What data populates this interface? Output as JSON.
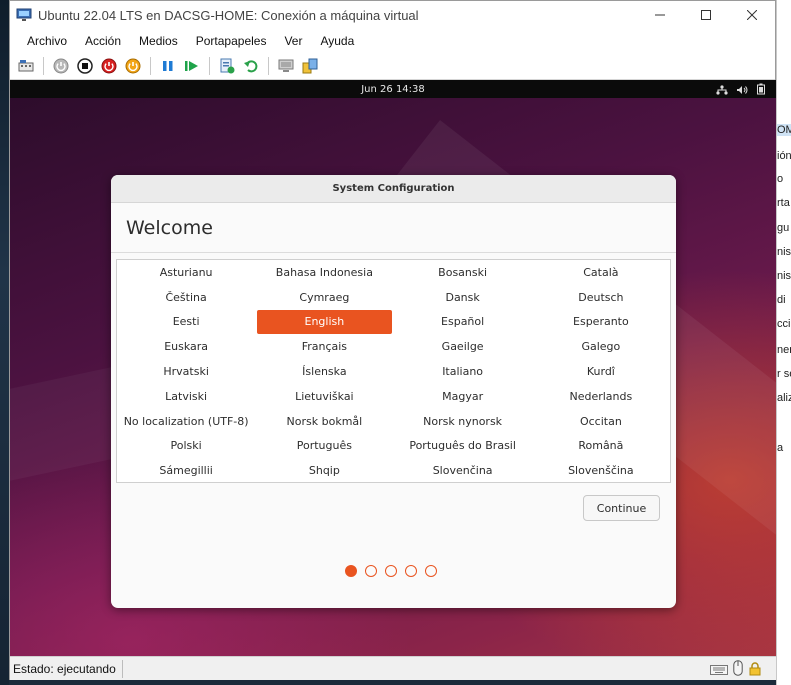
{
  "window": {
    "title": "Ubuntu 22.04 LTS en DACSG-HOME: Conexión a máquina virtual",
    "icon": "hyperv-vm-icon",
    "controls": [
      "minimize-icon",
      "maximize-icon",
      "close-icon"
    ]
  },
  "menu": [
    {
      "label": "Archivo"
    },
    {
      "label": "Acción"
    },
    {
      "label": "Medios"
    },
    {
      "label": "Portapapeles"
    },
    {
      "label": "Ver"
    },
    {
      "label": "Ayuda"
    }
  ],
  "toolbar": [
    "ctrl-alt-del-icon",
    "start-icon",
    "turn-off-icon",
    "shutdown-icon",
    "save-icon",
    "pause-icon",
    "resume-icon",
    "checkpoint-icon",
    "revert-icon",
    "enhanced-session-icon",
    "share-icon"
  ],
  "guest": {
    "clock": "Jun 26  14:38",
    "tray": [
      "network-icon",
      "volume-icon",
      "battery-icon"
    ]
  },
  "dialog": {
    "title": "System Configuration",
    "heading": "Welcome",
    "selected_language": "English",
    "languages": [
      "Asturianu",
      "Bahasa Indonesia",
      "Bosanski",
      "Català",
      "Čeština",
      "Cymraeg",
      "Dansk",
      "Deutsch",
      "Eesti",
      "English",
      "Español",
      "Esperanto",
      "Euskara",
      "Français",
      "Gaeilge",
      "Galego",
      "Hrvatski",
      "Íslenska",
      "Italiano",
      "Kurdî",
      "Latviski",
      "Lietuviškai",
      "Magyar",
      "Nederlands",
      "No localization (UTF-8)",
      "Norsk bokmål",
      "Norsk nynorsk",
      "Occitan",
      "Polski",
      "Português",
      "Português do Brasil",
      "Română",
      "Sámegillii",
      "Shqip",
      "Slovenčina",
      "Slovenščina"
    ],
    "continue_label": "Continue",
    "page_dots": {
      "total": 5,
      "current": 1
    }
  },
  "status": {
    "text": "Estado: ejecutando",
    "icons": [
      "keyboard-icon",
      "mouse-icon",
      "lock-icon"
    ]
  },
  "background_fragments": [
    "OM",
    "ión",
    "o",
    "rta",
    "gu",
    "nis",
    "nis",
    "di",
    "cci",
    "ner",
    "r se",
    "aliz",
    "a"
  ],
  "colors": {
    "accent": "#e95420",
    "topbar": "#0b0b0b"
  }
}
